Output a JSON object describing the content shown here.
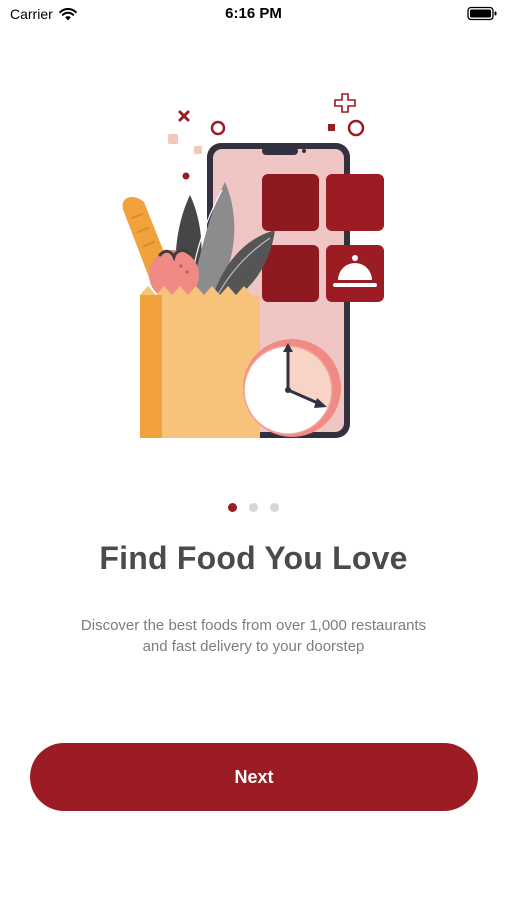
{
  "status_bar": {
    "carrier": "Carrier",
    "time": "6:16 PM"
  },
  "onboarding": {
    "page_count": 3,
    "active_page": 1,
    "title": "Find Food You Love",
    "description": "Discover the best foods from over 1,000 restaurants and fast delivery to your doorstep",
    "next_label": "Next",
    "illustration_icon": "food-delivery-illustration"
  },
  "colors": {
    "accent": "#9b1c22",
    "title_text": "#4a4b4d",
    "body_text": "#7c7d7e",
    "dot_inactive": "#d7d7d7"
  }
}
